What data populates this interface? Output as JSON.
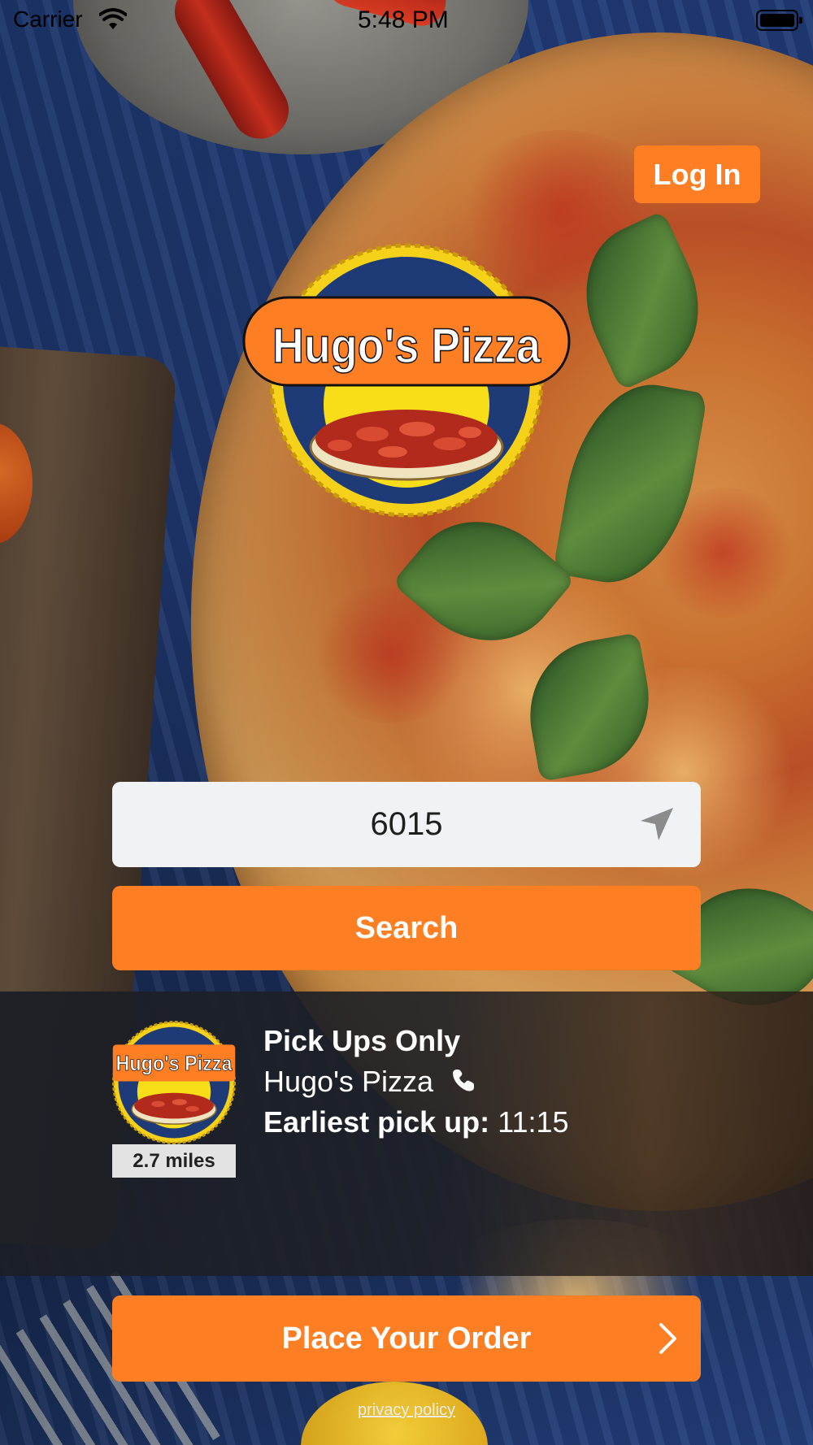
{
  "status_bar": {
    "carrier": "Carrier",
    "time": "5:48 PM"
  },
  "header": {
    "login_label": "Log In"
  },
  "brand": {
    "name": "Hugo's Pizza",
    "accent_color": "#fd7e23"
  },
  "search": {
    "location_value": "6015",
    "button_label": "Search",
    "locate_icon": "location-arrow-icon"
  },
  "store": {
    "service_type": "Pick Ups Only",
    "name": "Hugo's Pizza",
    "earliest_label": "Earliest pick up:",
    "earliest_time": "11:15",
    "distance": "2.7 miles",
    "phone_icon": "phone-icon"
  },
  "order": {
    "button_label": "Place Your Order",
    "icon": "chevron-right-icon"
  },
  "footer": {
    "privacy_label": "privacy policy"
  }
}
